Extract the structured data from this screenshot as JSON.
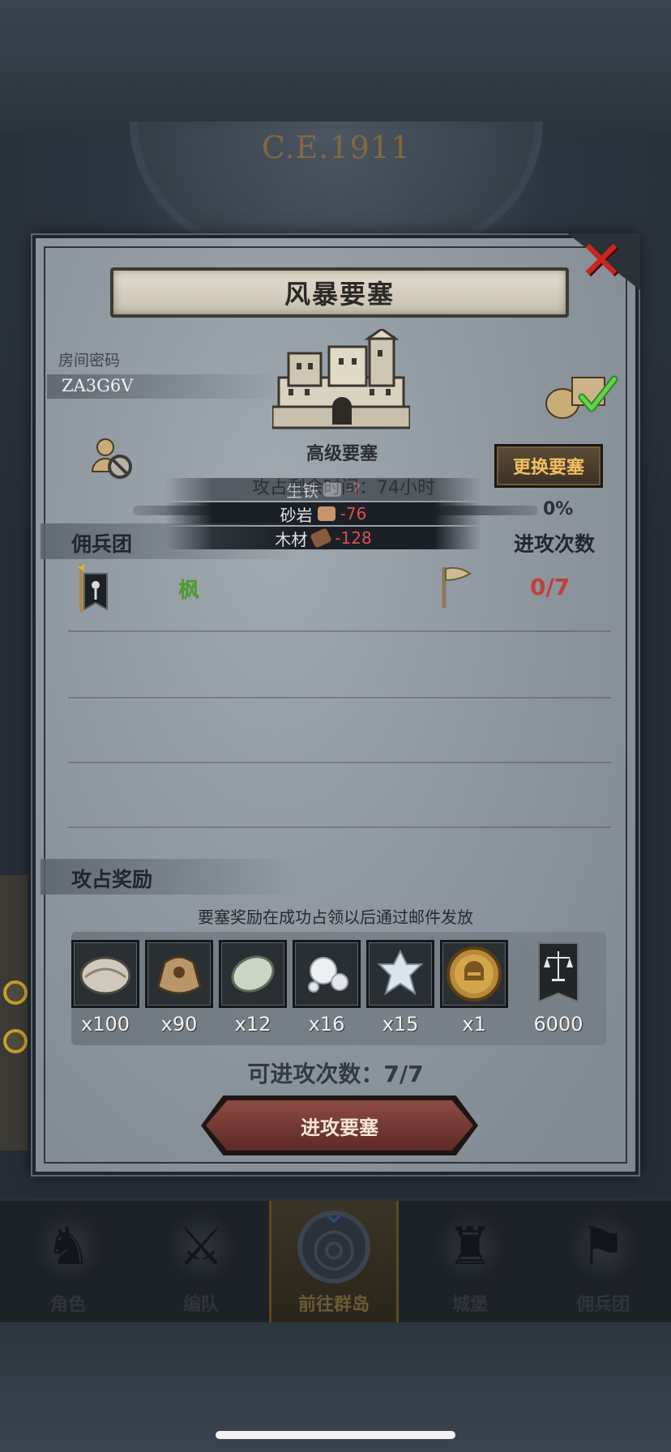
{
  "background": {
    "dial_year": "C.E.1911"
  },
  "modal": {
    "title": "风暴要塞",
    "close_icon": "close-x-icon",
    "room": {
      "label": "房间密码",
      "code": "ZA3G6V"
    },
    "fortress": {
      "name": "高级要塞"
    },
    "change_button": "更换要塞",
    "time_remaining": "攻占剩余时间：74小时",
    "progress": {
      "value": 0,
      "label": "0%"
    },
    "costs": [
      {
        "name": "生铁",
        "value": "-?",
        "icon": "iron-icon"
      },
      {
        "name": "砂岩",
        "value": "-76",
        "icon": "sandstone-icon"
      },
      {
        "name": "木材",
        "value": "-128",
        "icon": "wood-icon"
      }
    ],
    "mercenary": {
      "section_title": "佣兵团",
      "attacks_title": "进攻次数",
      "name": "枫",
      "attack_count": "0/7"
    },
    "rewards": {
      "section_title": "攻占奖励",
      "note": "要塞奖励在成功占领以后通过邮件发放",
      "items": [
        {
          "icon": "oyster-icon",
          "qty": "x100"
        },
        {
          "icon": "sack-icon",
          "qty": "x90"
        },
        {
          "icon": "jade-stone-icon",
          "qty": "x12"
        },
        {
          "icon": "pearl-icon",
          "qty": "x16"
        },
        {
          "icon": "crystal-icon",
          "qty": "x15"
        },
        {
          "icon": "helmet-medal-icon",
          "qty": "x1"
        },
        {
          "icon": "justice-banner-icon",
          "qty": "6000"
        }
      ]
    },
    "attempts": "可进攻次数：7/7",
    "attack_button": "进攻要塞"
  },
  "bottom_nav": [
    {
      "label": "角色",
      "icon": "character-icon",
      "active": false
    },
    {
      "label": "编队",
      "icon": "formation-icon",
      "active": false
    },
    {
      "label": "前往群岛",
      "icon": "islands-globe-icon",
      "active": true
    },
    {
      "label": "城堡",
      "icon": "castle-icon",
      "active": false
    },
    {
      "label": "佣兵团",
      "icon": "mercenary-icon",
      "active": false
    }
  ],
  "colors": {
    "accent_red": "#c0403a",
    "merc_green": "#4e9a2e",
    "gold": "#f0c062"
  }
}
